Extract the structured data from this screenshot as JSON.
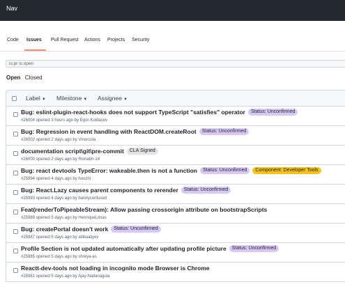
{
  "nav": {
    "title": "Nav"
  },
  "tabs": [
    {
      "label": "Code"
    },
    {
      "label": "Issues"
    },
    {
      "label": "Pull Request"
    },
    {
      "label": "Actions"
    },
    {
      "label": "Projects"
    },
    {
      "label": "Security"
    }
  ],
  "search": {
    "value": "is:pr is:open"
  },
  "state_filter": {
    "open": "Open",
    "closed": "Closed"
  },
  "filters": {
    "label": "Label",
    "milestone": "Milestone",
    "assignee": "Assignee",
    "caret": "▼"
  },
  "colors": {
    "label_unconfirmed": "#d8c8f5",
    "label_cla": "#e3e3e3",
    "label_component": "#f5c31b",
    "active_tab_underline": "#fd8c73",
    "topbar": "#24292f"
  },
  "issues": [
    {
      "title": "Bug: eslint-plugin-react-hooks does not support TypeScript \"satisfies\" operator",
      "labels": [
        "Status: Unconfirmed"
      ],
      "meta": "#26004 opened 3 hours ago by Egor-Koldasov"
    },
    {
      "title": "Bug: Regression in event handling with ReactDOM.createRoot",
      "labels": [
        "Status: Unconfirmed"
      ],
      "meta": "#26002 opened 2 days ago by Vinorcola"
    },
    {
      "title": "documentation script\\git\\pre-commit",
      "labels": [
        "CLA Signed"
      ],
      "meta": "#26000 opened 2 days ago by Rishabh-14"
    },
    {
      "title": "Bug: react devtools TypeError: wakeable.then is not a function",
      "labels": [
        "Status: Unconfirmed",
        "Component: Developer Tools"
      ],
      "meta": "#25994 opened 4 days ago by huozhi"
    },
    {
      "title": "Bug: React.Lazy causes parent components to rerender",
      "labels": [
        "Status: Unconfirmed"
      ],
      "meta": "#25993 opened 4 days ago by barelyconfused"
    },
    {
      "title": "Feat(renderToPipeableStream): Allow passing crossorigin attribute on bootstrapScripts",
      "labels": [],
      "meta": "#25989 opened 5 days ago by HenriqueLimas"
    },
    {
      "title": "Bug: createPortal doesn't work",
      "labels": [
        "Status: Unconfirmed"
      ],
      "meta": "#25987 opened 5 days ago by atilliaaliyev"
    },
    {
      "title": "Profile Section is not updated automatically after updating profile picture",
      "labels": [
        "Status: Unconfirmed"
      ],
      "meta": "#25985 opened 5 days ago by shreya-as"
    },
    {
      "title": "Reactt-dev-tools not loading in incognito mode Browser is Chrome",
      "labels": [],
      "meta": "#25981 opened 5 days ago by Ajay-Nallanagula"
    }
  ]
}
